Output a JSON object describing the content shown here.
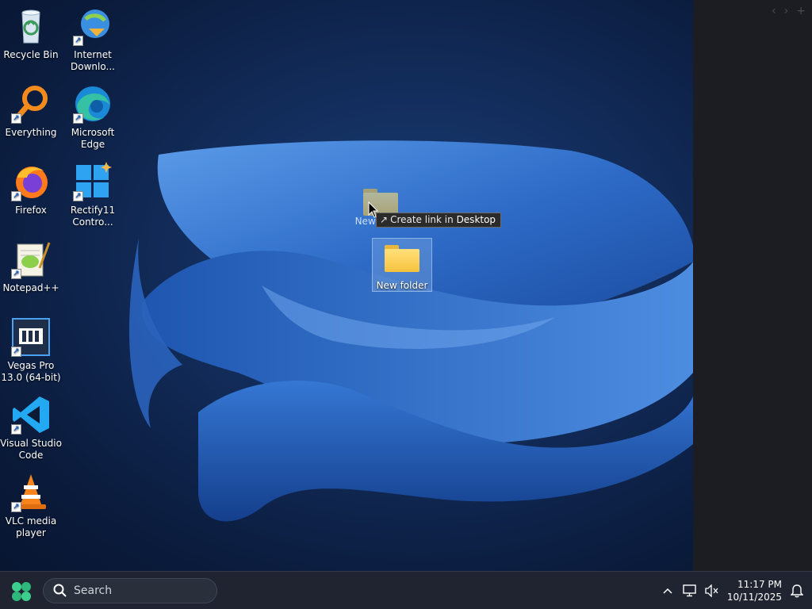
{
  "desktop_icons": [
    {
      "id": "recycle-bin",
      "label": "Recycle Bin",
      "shortcut": false
    },
    {
      "id": "internet-download-manager",
      "label": "Internet Downlo...",
      "shortcut": true
    },
    {
      "id": "everything",
      "label": "Everything",
      "shortcut": true
    },
    {
      "id": "microsoft-edge",
      "label": "Microsoft Edge",
      "shortcut": true
    },
    {
      "id": "firefox",
      "label": "Firefox",
      "shortcut": true
    },
    {
      "id": "rectify11",
      "label": "Rectify11 Contro...",
      "shortcut": true
    },
    {
      "id": "notepad-plus-plus",
      "label": "Notepad++",
      "shortcut": true
    },
    {
      "id": "vegas-pro",
      "label": "Vegas Pro 13.0 (64-bit)",
      "shortcut": true
    },
    {
      "id": "vs-code",
      "label": "Visual Studio Code",
      "shortcut": true
    },
    {
      "id": "vlc",
      "label": "VLC media player",
      "shortcut": true
    }
  ],
  "drag": {
    "ghost_label": "New folder",
    "selected_label": "New folder",
    "tooltip_action": "Create link in",
    "tooltip_target": "Desktop",
    "tooltip_arrow": "↗"
  },
  "side_panel": {
    "nav_back": "‹",
    "nav_forward": "›",
    "nav_add": "+"
  },
  "taskbar": {
    "search_placeholder": "Search",
    "time": "11:17 PM",
    "date": "10/11/2025",
    "tray_chevron": "^"
  },
  "colors": {
    "taskbar_bg": "#1f2430",
    "wallpaper_accent": "#2f6fd0",
    "selection": "#8cb4e6"
  }
}
